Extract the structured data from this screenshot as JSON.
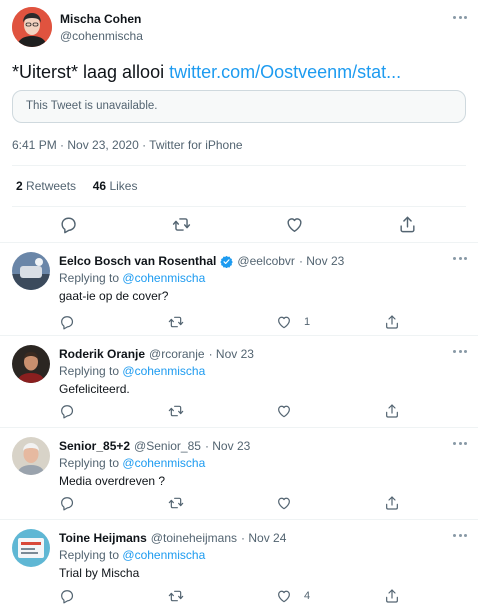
{
  "main_tweet": {
    "author_name": "Mischa Cohen",
    "author_handle": "@cohenmischa",
    "text": "*Uiterst* laag allooi",
    "link": "twitter.com/Oostveenm/stat...",
    "quoted_unavailable": "This Tweet is unavailable.",
    "timestamp": "6:41 PM · Nov 23, 2020 · Twitter for iPhone",
    "retweets_count": "2",
    "retweets_label": "Retweets",
    "likes_count": "46",
    "likes_label": "Likes"
  },
  "replies": [
    {
      "name": "Eelco Bosch van Rosenthal",
      "verified": true,
      "handle": "@eelcobvr",
      "date": "· Nov 23",
      "replying_prefix": "Replying to",
      "replying_to": "@cohenmischa",
      "text": "gaat-ie op de cover?",
      "like_count": "1"
    },
    {
      "name": "Roderik Oranje",
      "verified": false,
      "handle": "@rcoranje",
      "date": "· Nov 23",
      "replying_prefix": "Replying to",
      "replying_to": "@cohenmischa",
      "text": "Gefeliciteerd.",
      "like_count": ""
    },
    {
      "name": "Senior_85+2",
      "verified": false,
      "handle": "@Senior_85",
      "date": "· Nov 23",
      "replying_prefix": "Replying to",
      "replying_to": "@cohenmischa",
      "text": "Media overdreven ?",
      "like_count": ""
    },
    {
      "name": "Toine Heijmans",
      "verified": false,
      "handle": "@toineheijmans",
      "date": "· Nov 24",
      "replying_prefix": "Replying to",
      "replying_to": "@cohenmischa",
      "text": "Trial by Mischa",
      "like_count": "4"
    }
  ],
  "icons": {
    "reply": "reply-icon",
    "retweet": "retweet-icon",
    "like": "heart-icon",
    "share": "share-icon",
    "more": "more-icon",
    "verified": "verified-badge-icon"
  },
  "colors": {
    "accent": "#1d9bf0",
    "text": "#0f1419",
    "muted": "#536471"
  }
}
